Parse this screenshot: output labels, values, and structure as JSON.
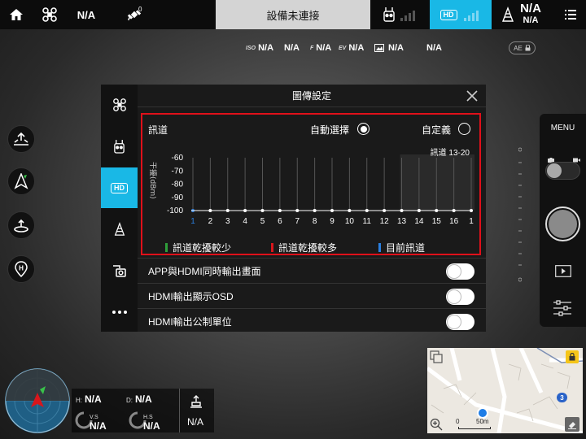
{
  "top_bar": {
    "aircraft_mode": "N/A",
    "gps_count": "0",
    "status_title": "設備未連接",
    "hd_badge": "HD",
    "battery_pct_top": "N/A",
    "battery_pct_bottom": "N/A"
  },
  "camera_params": [
    {
      "label": "ISO",
      "value": "N/A"
    },
    {
      "label": "",
      "value": "N/A"
    },
    {
      "label": "F",
      "value": "N/A"
    },
    {
      "label": "EV",
      "value": "N/A"
    },
    {
      "label": "",
      "value": "N/A"
    },
    {
      "label": "",
      "value": "N/A"
    }
  ],
  "ae_lock": "AE",
  "dialog": {
    "title": "圖傳設定",
    "sidebar_items": [
      "aircraft",
      "remote",
      "HD",
      "battery",
      "gimbal",
      "more"
    ],
    "channel_label": "訊道",
    "auto_label": "自動選擇",
    "custom_label": "自定義",
    "chart_data": {
      "type": "bar",
      "title": "訊道 13-20",
      "ylabel": "干擾(dBm)",
      "yticks": [
        "-60",
        "-70",
        "-80",
        "-90",
        "-100"
      ],
      "ylim": [
        -100,
        -60
      ],
      "categories": [
        "1",
        "2",
        "3",
        "4",
        "5",
        "6",
        "7",
        "8",
        "9",
        "10",
        "11",
        "12",
        "13",
        "14",
        "15",
        "16",
        "1"
      ],
      "values": [
        -100,
        -100,
        -100,
        -100,
        -100,
        -100,
        -100,
        -100,
        -100,
        -100,
        -100,
        -100,
        -100,
        -100,
        -100,
        -100,
        -100
      ],
      "current_channel": "1",
      "grid": true
    },
    "legend": [
      {
        "label": "訊道乾擾較少",
        "color": "#2e9e3a"
      },
      {
        "label": "訊道乾擾較多",
        "color": "#d9161c"
      },
      {
        "label": "目前訊道",
        "color": "#2a7fe0"
      }
    ],
    "toggles": [
      {
        "label": "APP與HDMI同時輸出畫面",
        "on": false
      },
      {
        "label": "HDMI輸出顯示OSD",
        "on": false
      },
      {
        "label": "HDMI輸出公制單位",
        "on": false
      }
    ]
  },
  "right_panel": {
    "menu_label": "MENU"
  },
  "map": {
    "scale_start": "0",
    "scale_label": "50m",
    "marker_num": "3"
  },
  "telemetry": {
    "h_label": "H:",
    "h_value": "N/A",
    "d_label": "D:",
    "d_value": "N/A",
    "vs_label": "V.S",
    "vs_value": "N/A",
    "hs_label": "H.S",
    "hs_value": "N/A",
    "extra_value": "N/A"
  }
}
